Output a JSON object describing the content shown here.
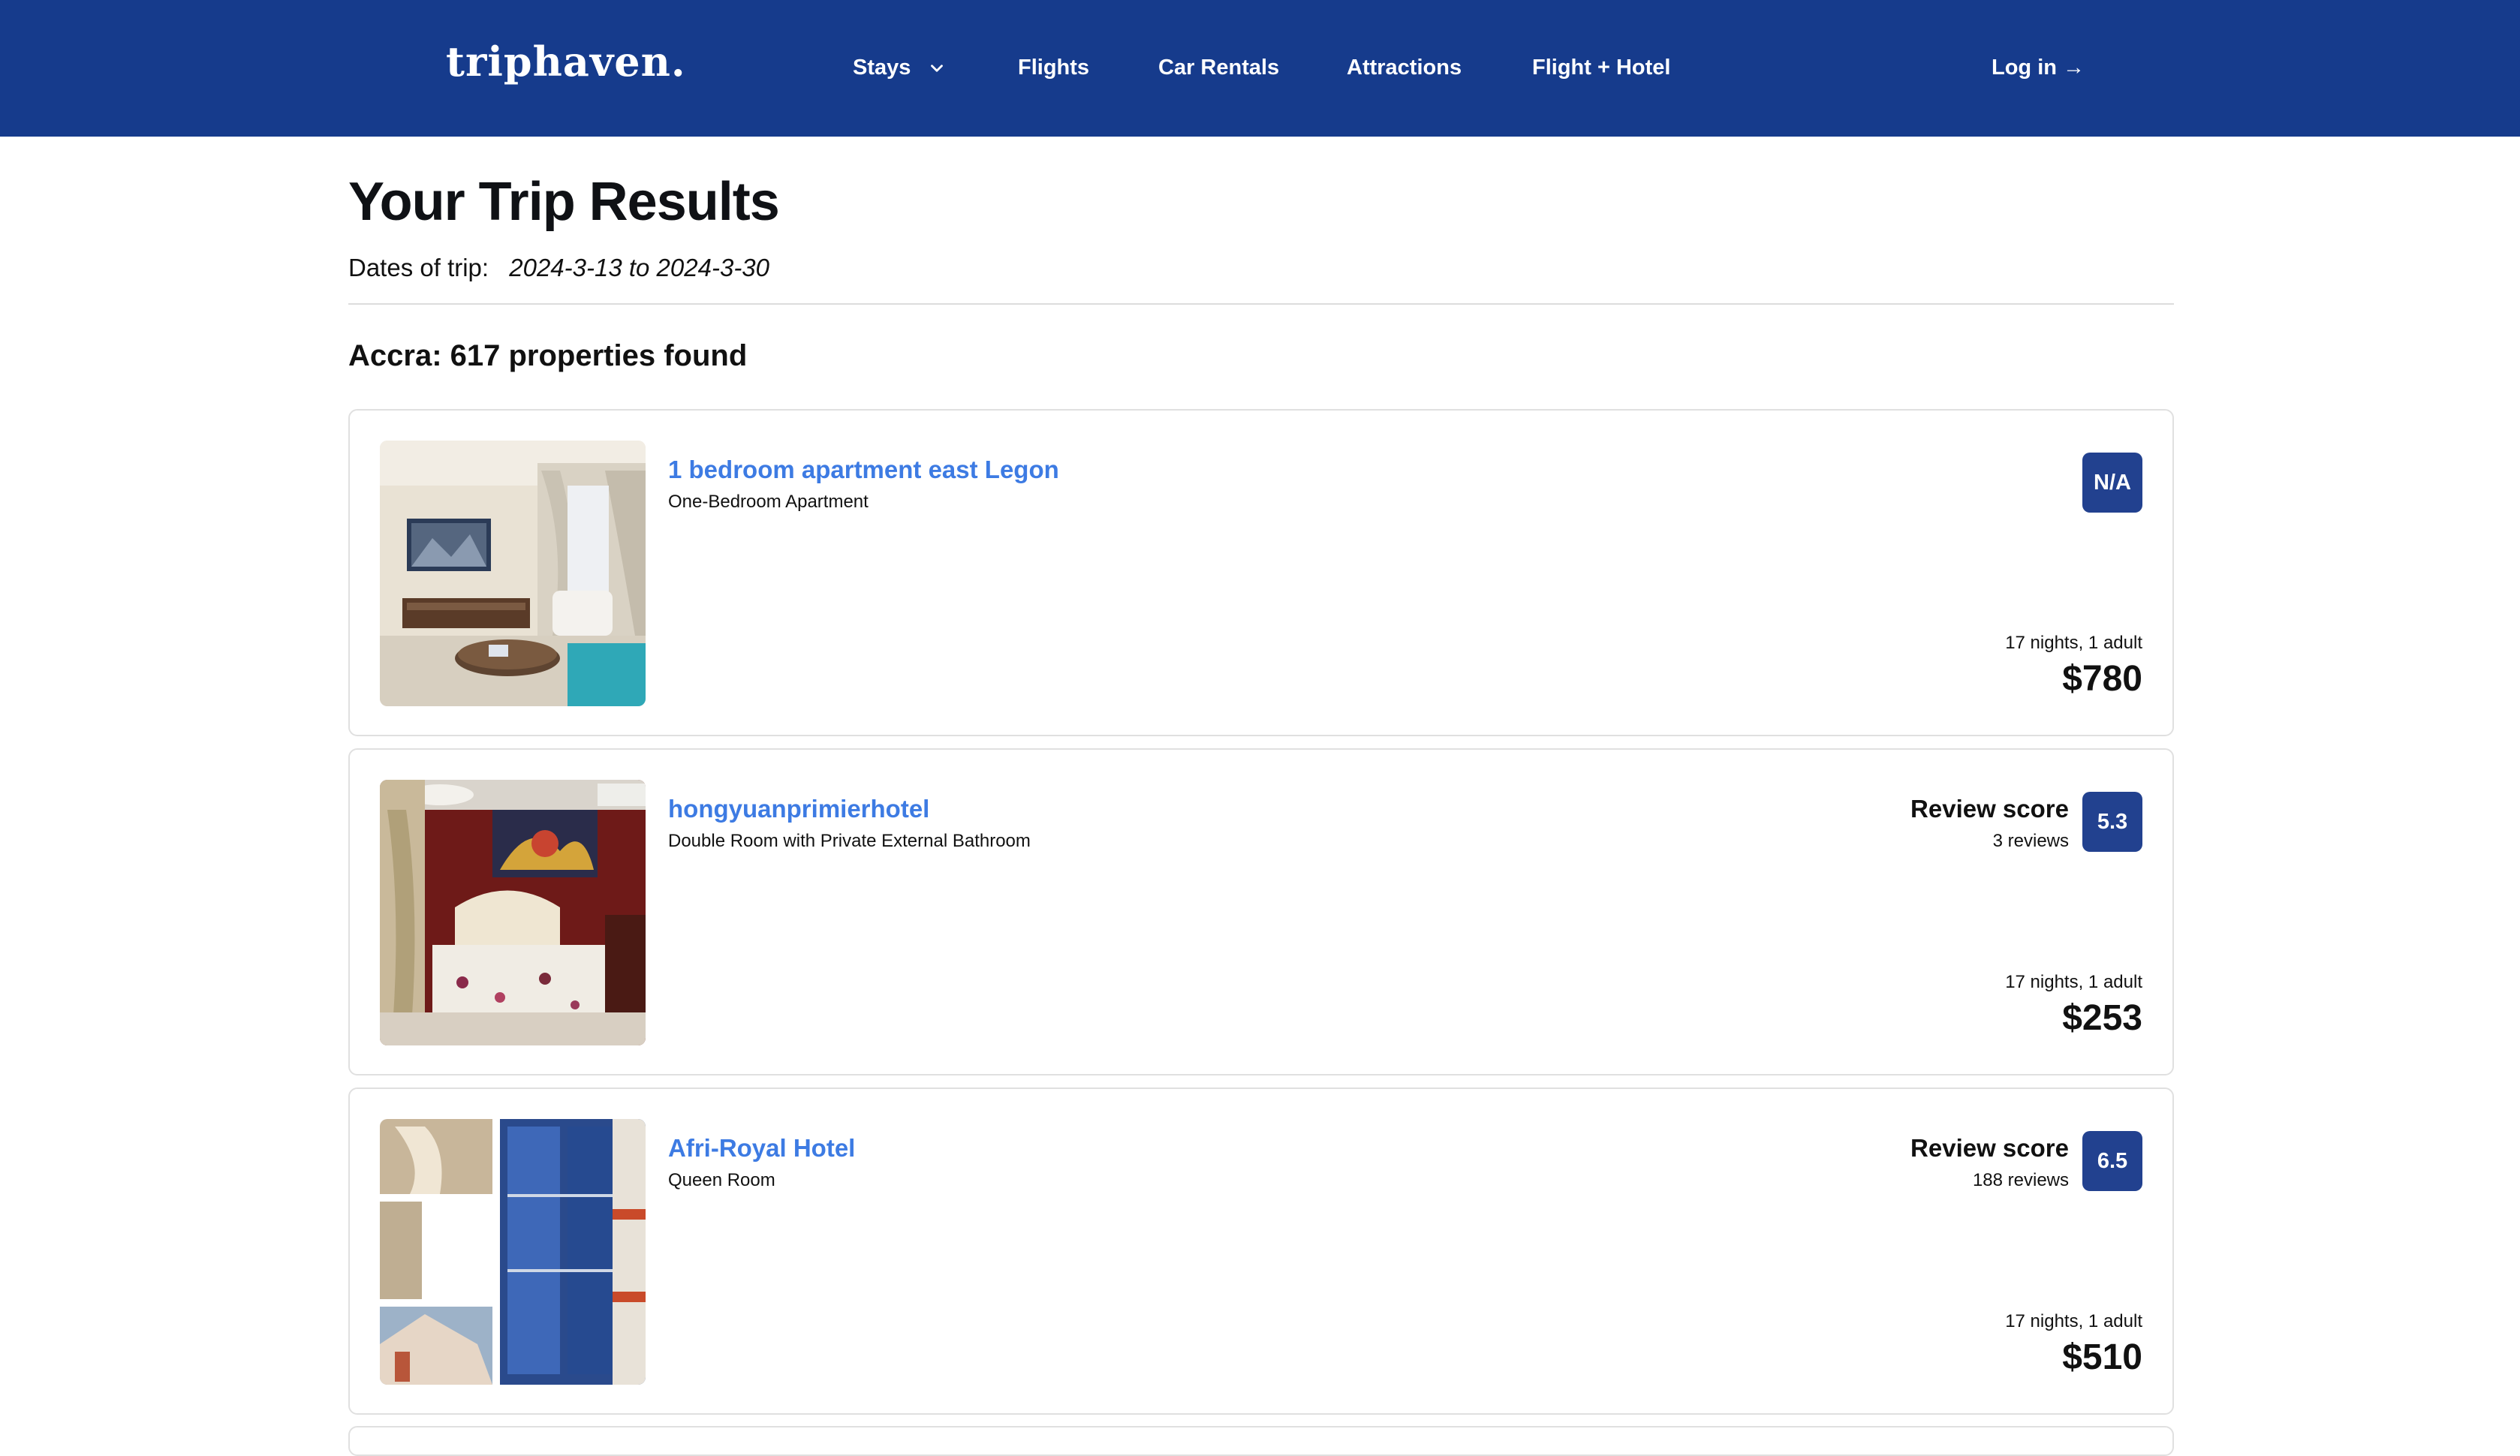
{
  "header": {
    "logo": "triphaven.",
    "nav": [
      {
        "label": "Stays"
      },
      {
        "label": "Flights"
      },
      {
        "label": "Car Rentals"
      },
      {
        "label": "Attractions"
      },
      {
        "label": "Flight + Hotel"
      }
    ],
    "login": "Log in →"
  },
  "page": {
    "title": "Your Trip Results",
    "dates_label": "Dates of trip:",
    "dates_value": "2024-3-13 to 2024-3-30",
    "results_heading": "Accra: 617 properties found"
  },
  "listings": [
    {
      "name": "1 bedroom apartment east Legon",
      "room": "One-Bedroom Apartment",
      "score": "N/A",
      "stay": "17 nights, 1 adult",
      "price": "$780"
    },
    {
      "name": "hongyuanprimierhotel",
      "room": "Double Room with Private External Bathroom",
      "review_label": "Review score",
      "reviews": "3 reviews",
      "score": "5.3",
      "stay": "17 nights, 1 adult",
      "price": "$253"
    },
    {
      "name": "Afri-Royal Hotel",
      "room": "Queen Room",
      "review_label": "Review score",
      "reviews": "188 reviews",
      "score": "6.5",
      "stay": "17 nights, 1 adult",
      "price": "$510"
    }
  ],
  "colors": {
    "navbar": "#163b8c",
    "link": "#3d7be3",
    "badge": "#22418f"
  }
}
